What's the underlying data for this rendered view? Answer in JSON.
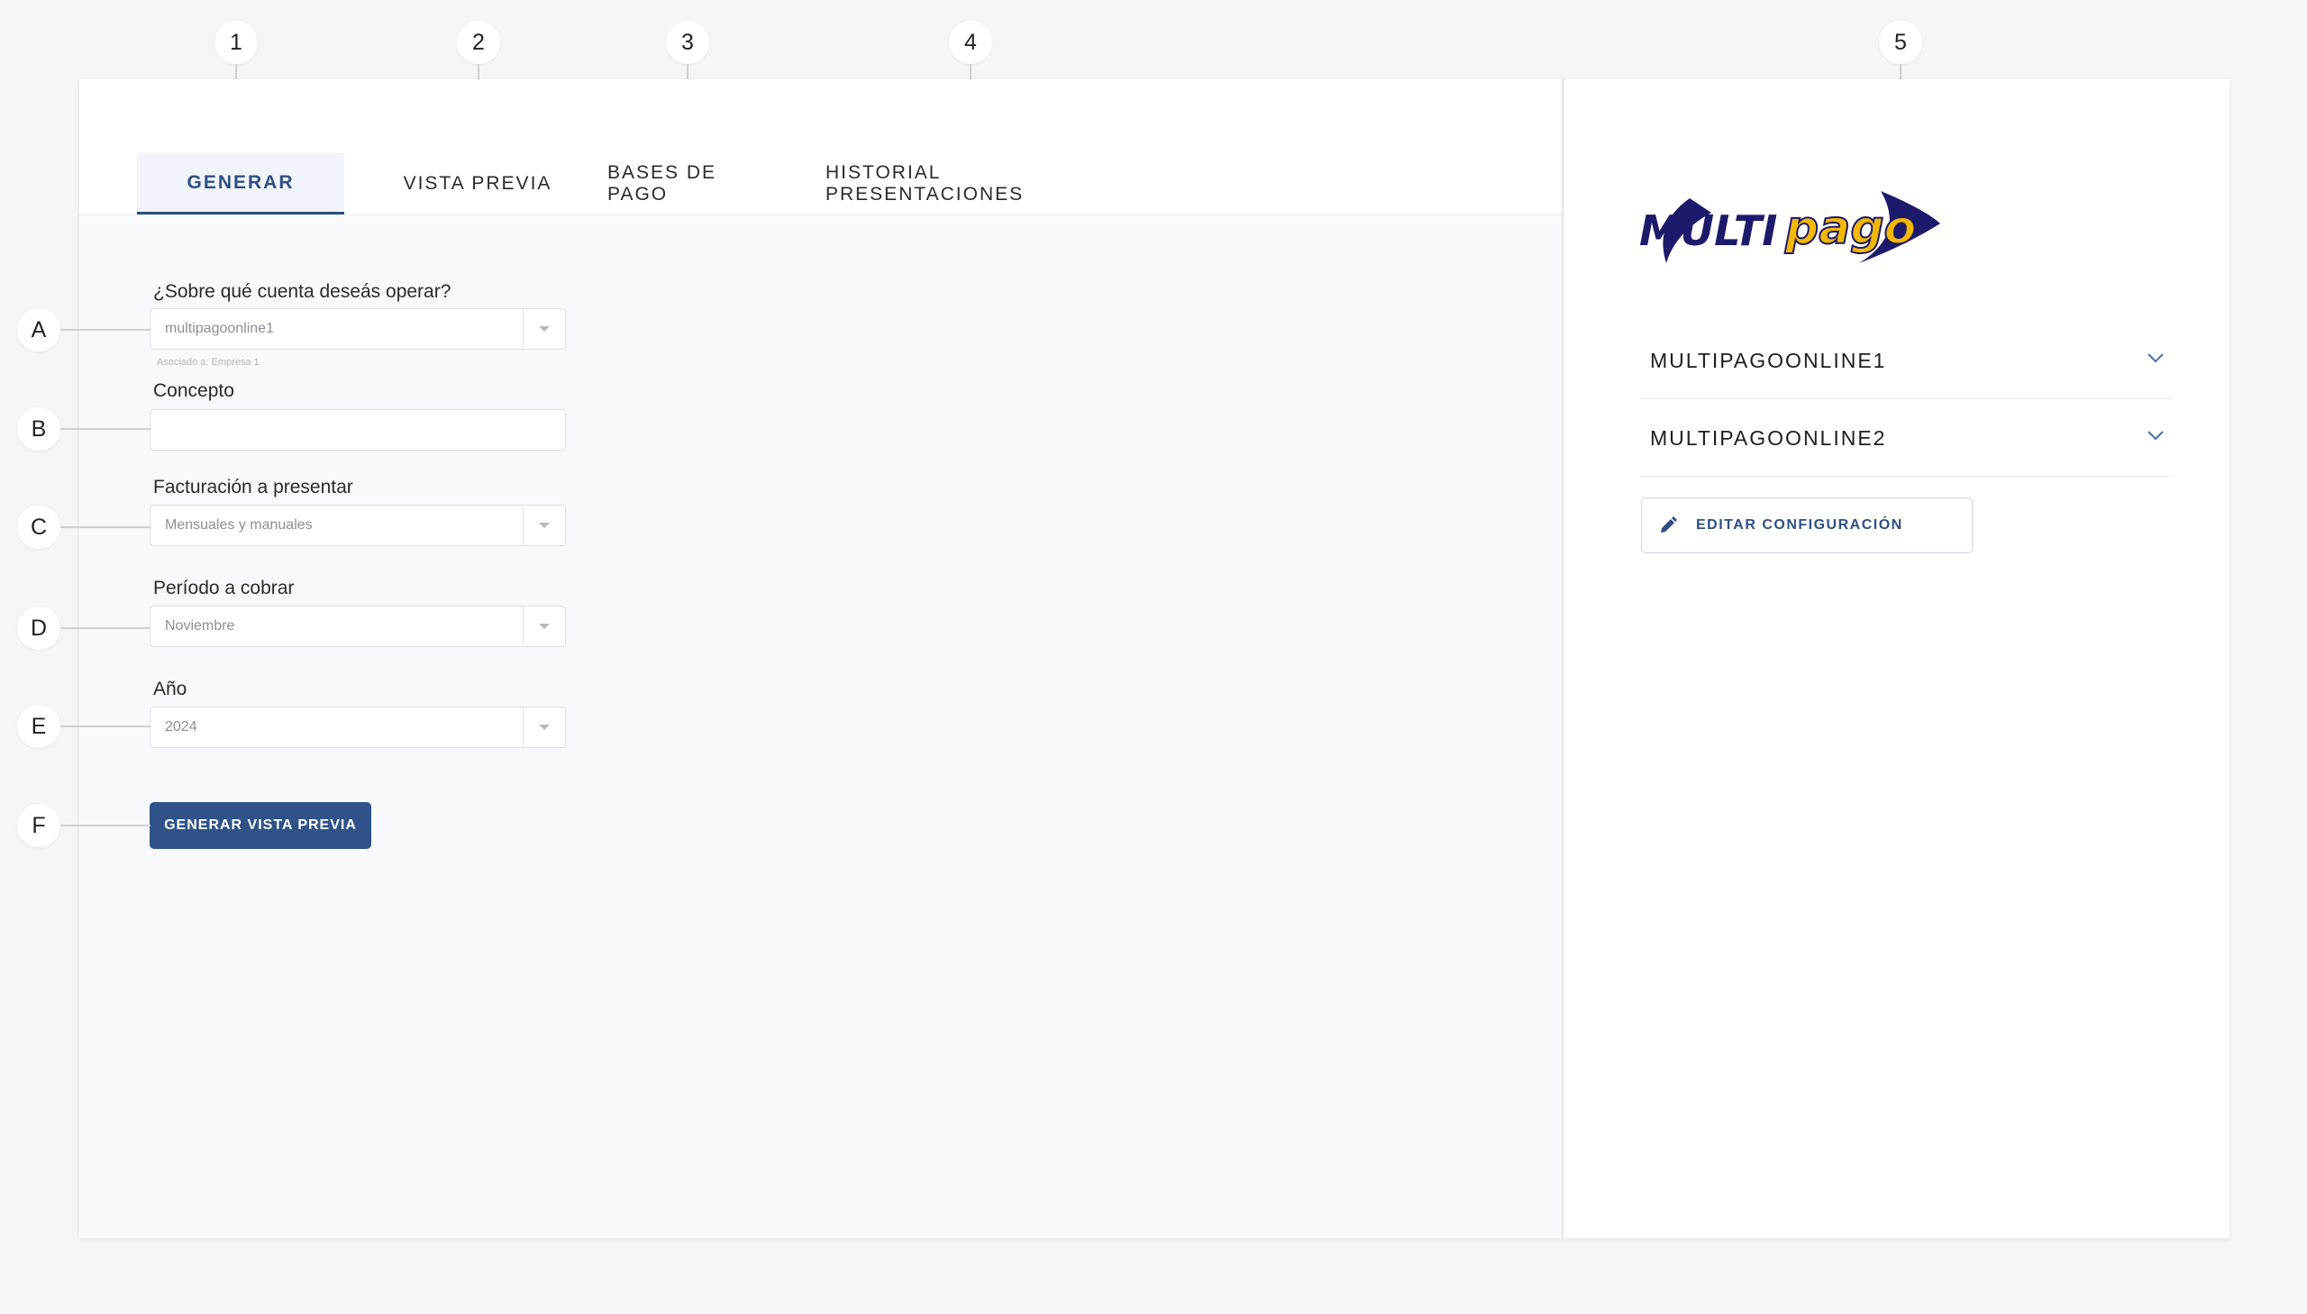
{
  "callouts": {
    "top": [
      "1",
      "2",
      "3",
      "4",
      "5"
    ],
    "left": [
      "A",
      "B",
      "C",
      "D",
      "E",
      "F"
    ]
  },
  "tabs": [
    {
      "label": "GENERAR",
      "active": true
    },
    {
      "label": "VISTA PREVIA",
      "active": false
    },
    {
      "label": "BASES DE PAGO",
      "active": false
    },
    {
      "label": "HISTORIAL PRESENTACIONES",
      "active": false
    }
  ],
  "form": {
    "account": {
      "label": "¿Sobre qué cuenta deseás operar?",
      "value": "multipagoonline1",
      "helper": "Asociado a: Empresa 1"
    },
    "concept": {
      "label": "Concepto",
      "value": ""
    },
    "billing": {
      "label": "Facturación a presentar",
      "value": "Mensuales y manuales"
    },
    "period": {
      "label": "Período a cobrar",
      "value": "Noviembre"
    },
    "year": {
      "label": "Año",
      "value": "2024"
    },
    "submit_label": "GENERAR VISTA PREVIA"
  },
  "sidebar": {
    "logo": {
      "part1": "MULTI",
      "part2": "pago"
    },
    "accounts": [
      {
        "label": "MULTIPAGOONLINE1"
      },
      {
        "label": "MULTIPAGOONLINE2"
      }
    ],
    "edit_label": "EDITAR CONFIGURACIÓN"
  },
  "colors": {
    "primary": "#2f5389",
    "logo_navy": "#1d1a6b",
    "logo_yellow": "#f4b800",
    "background": "#f5f5f5"
  }
}
